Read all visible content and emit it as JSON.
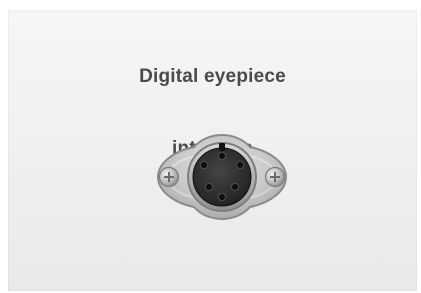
{
  "label": {
    "line1": "Digital eyepiece",
    "line2": "interface"
  },
  "colors": {
    "panel_bg": "#efefef",
    "label_text": "#4a4a4a",
    "connector_metal": "#b7b7b7",
    "connector_socket": "#2a2a2a"
  },
  "icons": {
    "connector": "din-connector-icon",
    "left_screw": "screw-icon",
    "right_screw": "screw-icon"
  }
}
